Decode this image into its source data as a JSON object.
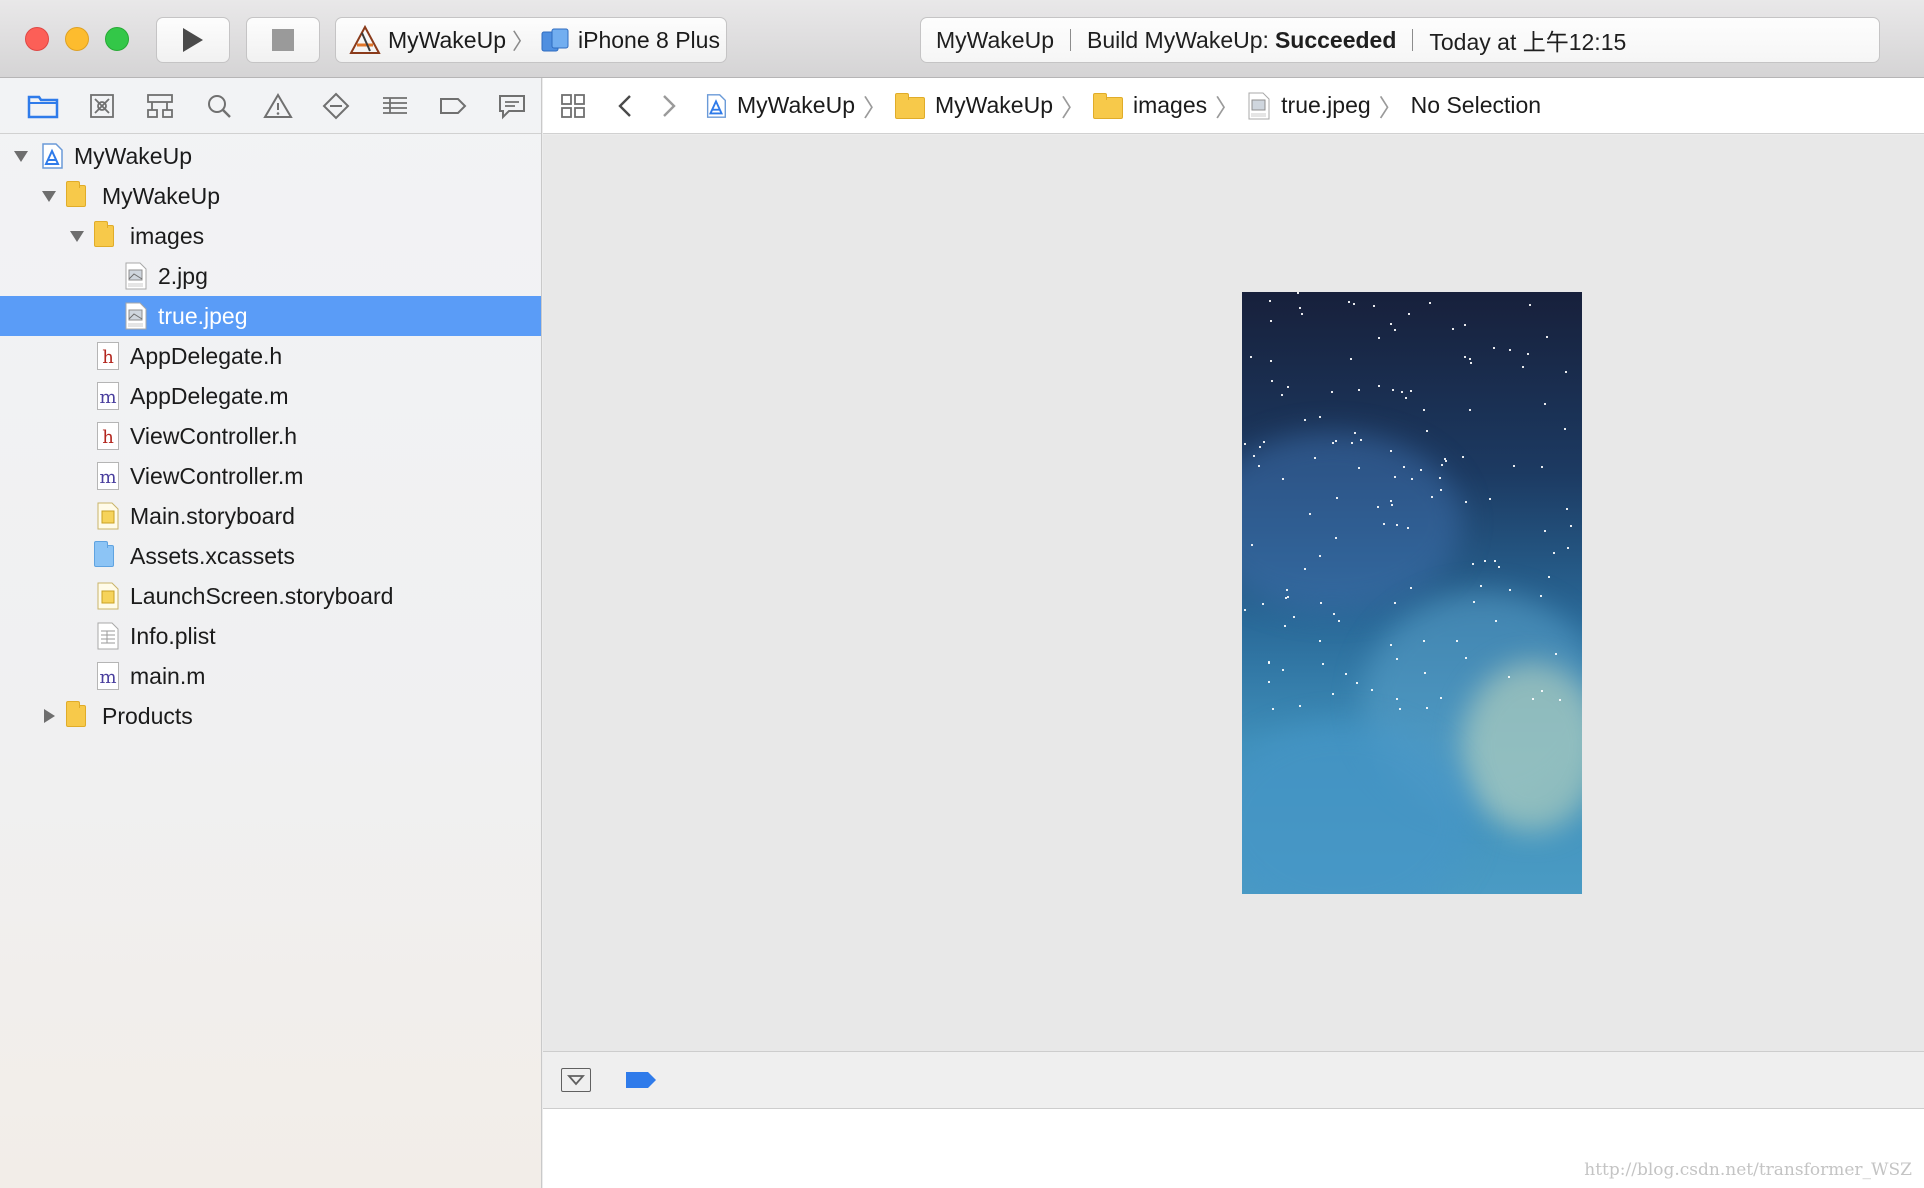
{
  "toolbar": {
    "scheme": {
      "project": "MyWakeUp",
      "device": "iPhone 8 Plus"
    },
    "activity": {
      "project": "MyWakeUp",
      "build_prefix": "Build MyWakeUp:",
      "build_status": "Succeeded",
      "time": "Today at 上午12:15"
    }
  },
  "navigator": {
    "tabs": [
      "project-navigator",
      "source-control-navigator",
      "symbol-navigator",
      "find-navigator",
      "issue-navigator",
      "test-navigator",
      "debug-navigator",
      "breakpoint-navigator",
      "report-navigator"
    ],
    "tree": [
      {
        "label": "MyWakeUp",
        "level": 0,
        "kind": "project",
        "disclosure": "open"
      },
      {
        "label": "MyWakeUp",
        "level": 1,
        "kind": "folder",
        "disclosure": "open"
      },
      {
        "label": "images",
        "level": 2,
        "kind": "folder",
        "disclosure": "open"
      },
      {
        "label": "2.jpg",
        "level": 3,
        "kind": "jpeg"
      },
      {
        "label": "true.jpeg",
        "level": 3,
        "kind": "jpeg",
        "selected": true
      },
      {
        "label": "AppDelegate.h",
        "level": 2,
        "kind": "h"
      },
      {
        "label": "AppDelegate.m",
        "level": 2,
        "kind": "m"
      },
      {
        "label": "ViewController.h",
        "level": 2,
        "kind": "h"
      },
      {
        "label": "ViewController.m",
        "level": 2,
        "kind": "m"
      },
      {
        "label": "Main.storyboard",
        "level": 2,
        "kind": "storyboard"
      },
      {
        "label": "Assets.xcassets",
        "level": 2,
        "kind": "assets"
      },
      {
        "label": "LaunchScreen.storyboard",
        "level": 2,
        "kind": "storyboard"
      },
      {
        "label": "Info.plist",
        "level": 2,
        "kind": "plist"
      },
      {
        "label": "main.m",
        "level": 2,
        "kind": "m"
      },
      {
        "label": "Products",
        "level": 1,
        "kind": "folder",
        "disclosure": "closed"
      }
    ]
  },
  "jumpbar": {
    "crumbs": [
      {
        "label": "MyWakeUp",
        "kind": "project"
      },
      {
        "label": "MyWakeUp",
        "kind": "folder"
      },
      {
        "label": "images",
        "kind": "folder"
      },
      {
        "label": "true.jpeg",
        "kind": "jpeg"
      },
      {
        "label": "No Selection",
        "kind": "none"
      }
    ]
  },
  "watermark": "http://blog.csdn.net/transformer_WSZ",
  "colors": {
    "selection": "#5a9cf7",
    "accent": "#2f7bea",
    "folder": "#f7c94a"
  }
}
